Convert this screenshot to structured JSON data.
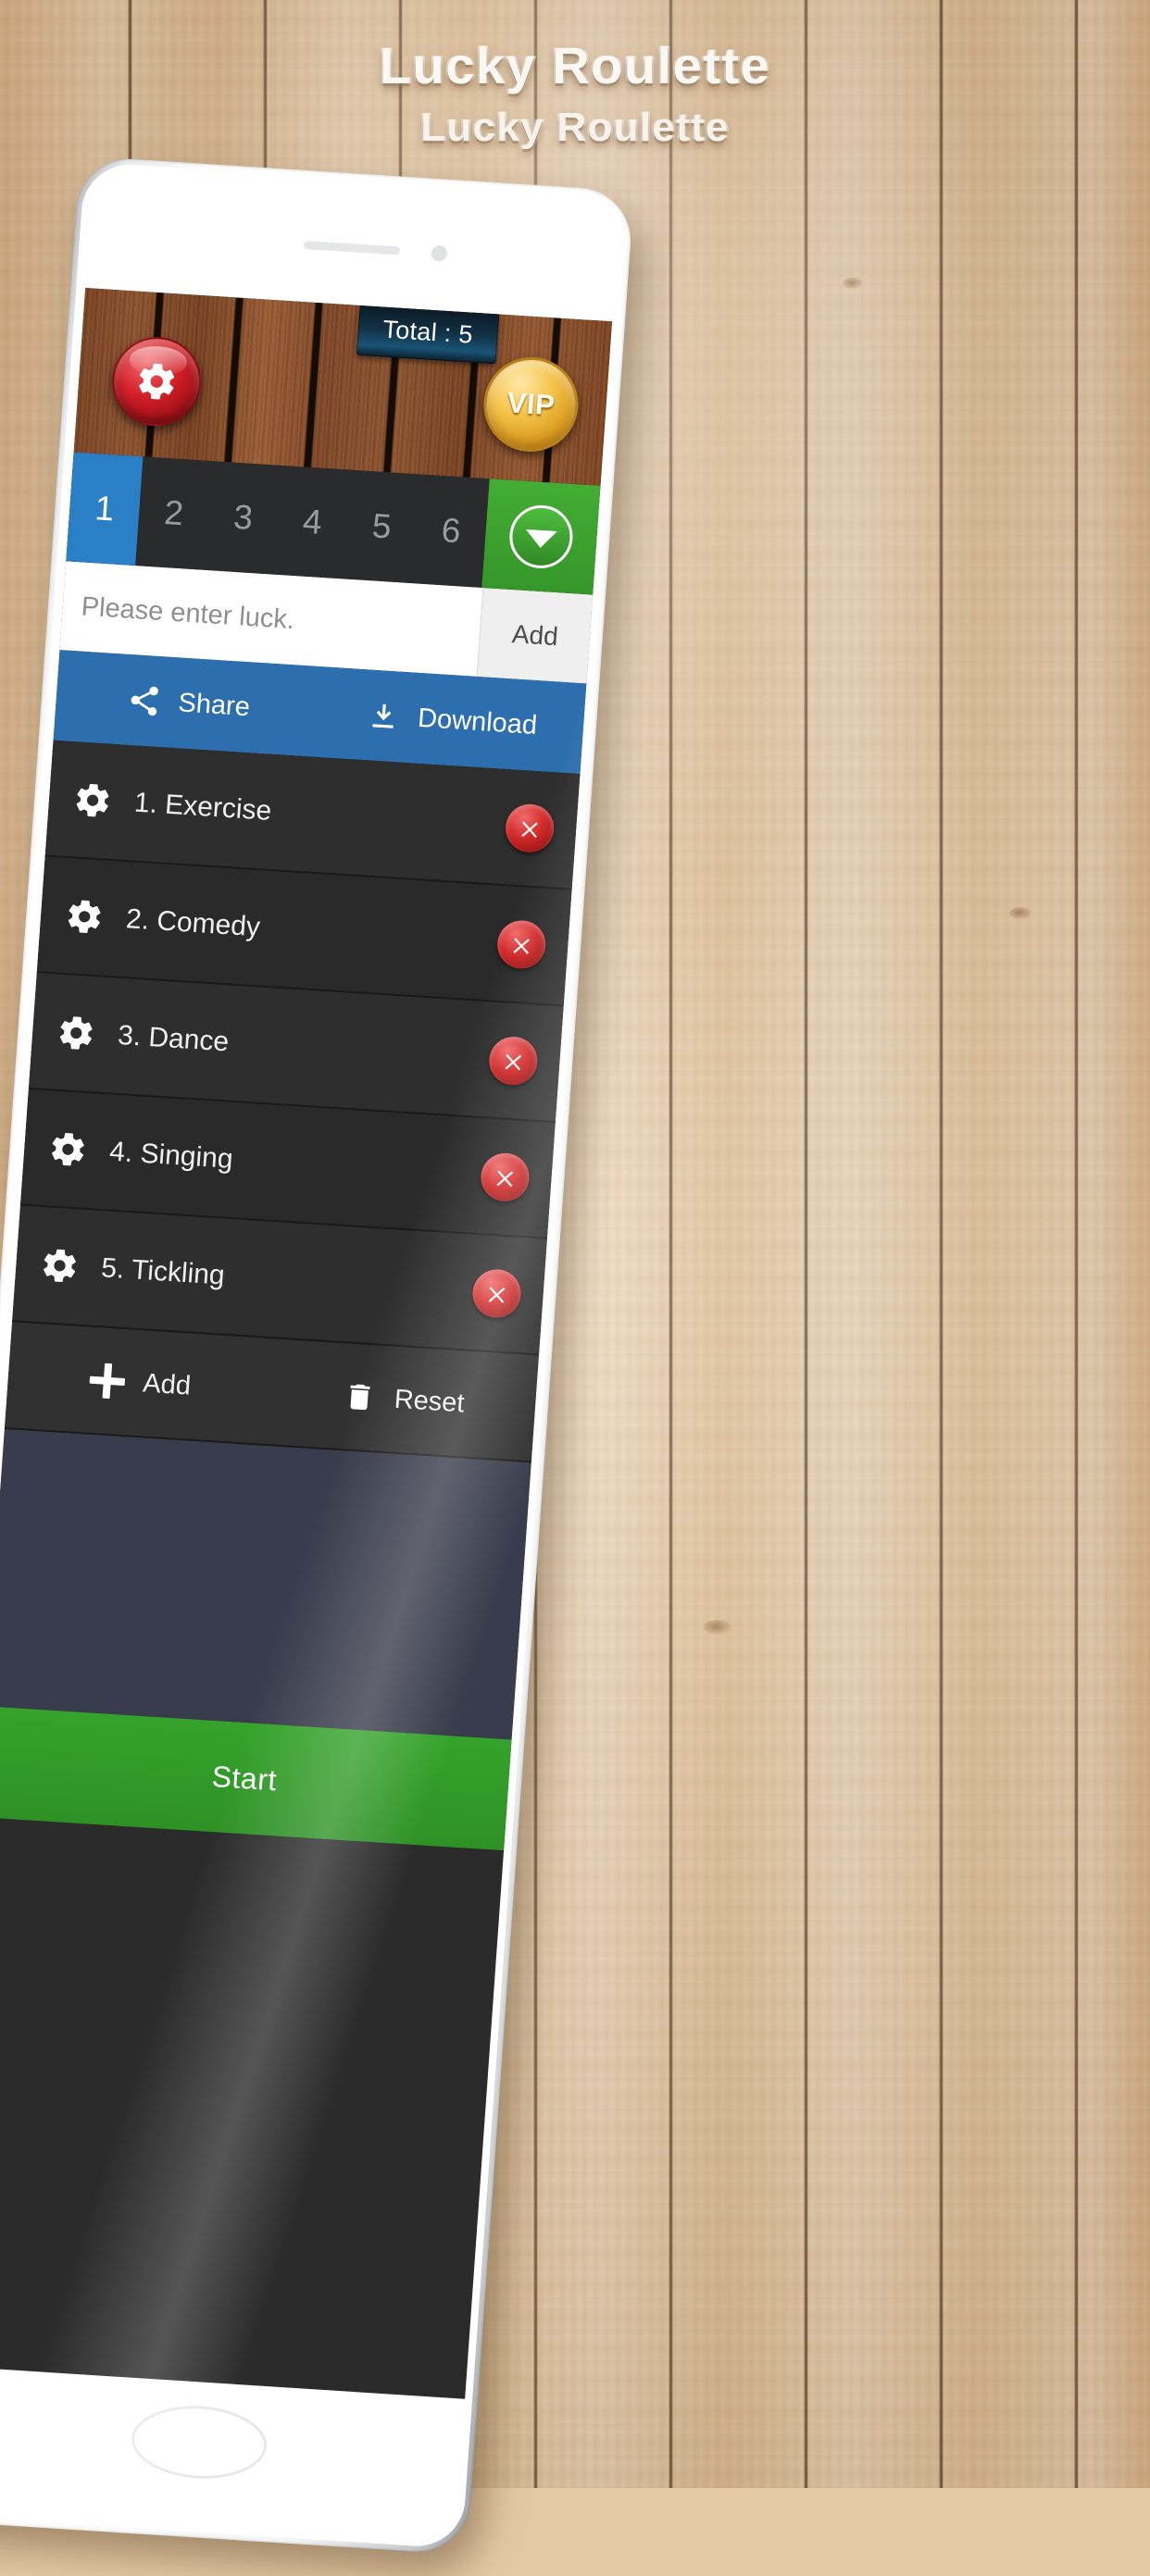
{
  "poster": {
    "main_title": "Lucky Roulette",
    "sub_title": "Lucky Roulette"
  },
  "app": {
    "header": {
      "total_label": "Total : 5",
      "settings_icon": "gear-icon",
      "vip_label": "VIP"
    },
    "tabs": {
      "items": [
        {
          "label": "1",
          "selected": true
        },
        {
          "label": "2",
          "selected": false
        },
        {
          "label": "3",
          "selected": false
        },
        {
          "label": "4",
          "selected": false
        },
        {
          "label": "5",
          "selected": false
        },
        {
          "label": "6",
          "selected": false
        }
      ],
      "dropdown_icon": "chevron-down-icon"
    },
    "input_row": {
      "placeholder": "Please enter luck.",
      "value": "",
      "add_label": "Add"
    },
    "action_bar": {
      "share_label": "Share",
      "share_icon": "share-icon",
      "download_label": "Download",
      "download_icon": "download-icon",
      "background": "#2d6fae"
    },
    "list": {
      "items": [
        {
          "label": "1. Exercise",
          "icon": "gear-icon",
          "delete_icon": "close-icon"
        },
        {
          "label": "2. Comedy",
          "icon": "gear-icon",
          "delete_icon": "close-icon"
        },
        {
          "label": "3. Dance",
          "icon": "gear-icon",
          "delete_icon": "close-icon"
        },
        {
          "label": "4. Singing",
          "icon": "gear-icon",
          "delete_icon": "close-icon"
        },
        {
          "label": "5. Tickling",
          "icon": "gear-icon",
          "delete_icon": "close-icon"
        }
      ]
    },
    "footer_actions": {
      "add_label": "Add",
      "add_icon": "plus-icon",
      "reset_label": "Reset",
      "reset_icon": "trash-icon"
    },
    "start_button": {
      "label": "Start",
      "color": "#35a32b"
    }
  },
  "colors": {
    "accent_blue": "#2b7fc7",
    "green": "#35a32b",
    "red": "#d21f28",
    "gold": "#f5c34a",
    "dark_row": "#2e2e2e"
  }
}
